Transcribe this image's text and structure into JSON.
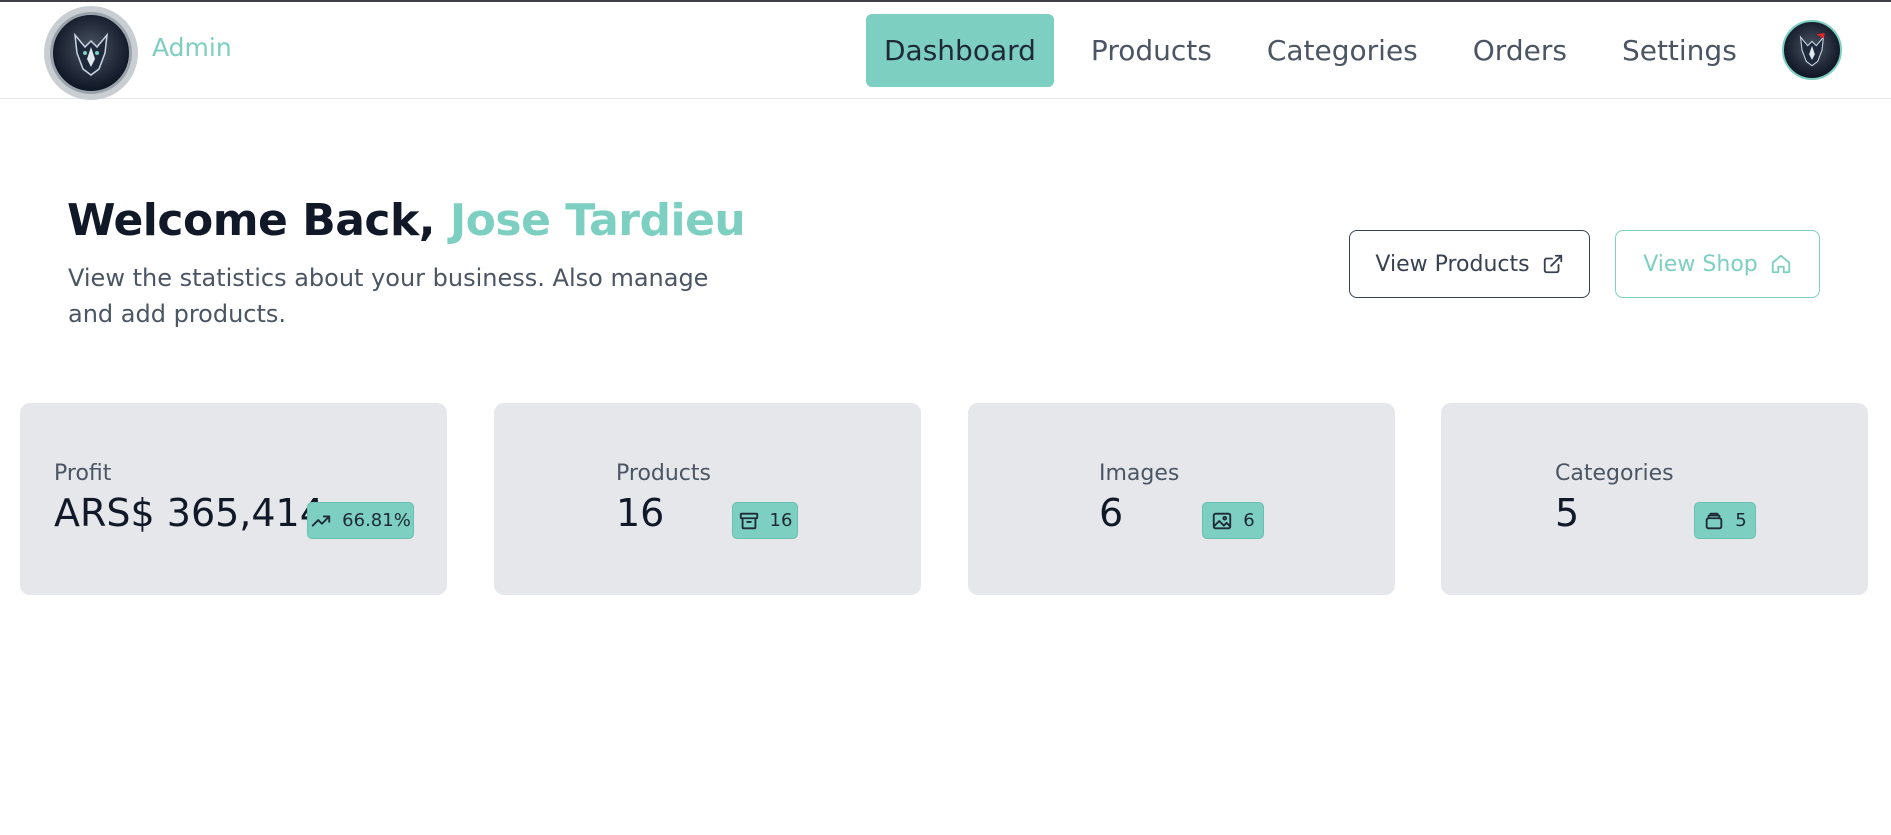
{
  "header": {
    "brand": "Admin",
    "nav": [
      {
        "label": "Dashboard",
        "active": true
      },
      {
        "label": "Products",
        "active": false
      },
      {
        "label": "Categories",
        "active": false
      },
      {
        "label": "Orders",
        "active": false
      },
      {
        "label": "Settings",
        "active": false
      }
    ]
  },
  "hero": {
    "greeting": "Welcome Back, ",
    "user_name": "Jose Tardieu",
    "subtitle": "View the statistics about your business. Also manage and add products.",
    "view_products_label": "View Products",
    "view_shop_label": "View Shop"
  },
  "stats": [
    {
      "label": "Profit",
      "value": "ARS$ 365,414",
      "badge": "66.81%",
      "icon": "trending-up-icon"
    },
    {
      "label": "Products",
      "value": "16",
      "badge": "16",
      "icon": "archive-icon"
    },
    {
      "label": "Images",
      "value": "6",
      "badge": "6",
      "icon": "image-icon"
    },
    {
      "label": "Categories",
      "value": "5",
      "badge": "5",
      "icon": "layers-icon"
    }
  ],
  "colors": {
    "accent": "#7ccfc1",
    "card_bg": "#e5e7eb",
    "text_dark": "#111827",
    "text_muted": "#4b5563"
  }
}
